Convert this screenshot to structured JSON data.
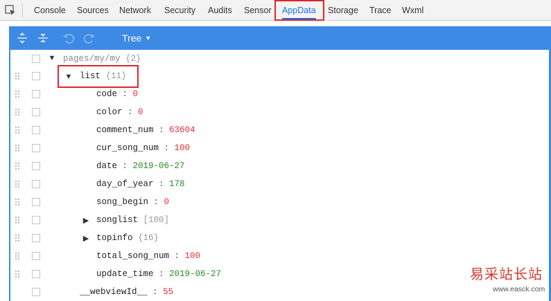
{
  "devtools": {
    "tabs": [
      {
        "label": "Console"
      },
      {
        "label": "Sources"
      },
      {
        "label": "Network"
      },
      {
        "label": "Security"
      },
      {
        "label": "Audits"
      },
      {
        "label": "Sensor"
      },
      {
        "label": "AppData",
        "active": true
      },
      {
        "label": "Storage"
      },
      {
        "label": "Trace"
      },
      {
        "label": "Wxml"
      }
    ],
    "accent_color": "#1a73e8",
    "highlight_color": "#e0242a"
  },
  "toolbar": {
    "background": "#3c8ae4",
    "icons": [
      "expand-all-icon",
      "collapse-all-icon",
      "undo-icon",
      "redo-icon"
    ],
    "view_mode": "Tree"
  },
  "tree": {
    "root": {
      "key": "pages/my/my",
      "count": "{2}"
    },
    "list": {
      "key": "list",
      "count": "{11}"
    },
    "list_items": [
      {
        "key": "code",
        "value": "0",
        "type": "num"
      },
      {
        "key": "color",
        "value": "0",
        "type": "num"
      },
      {
        "key": "comment_num",
        "value": "63604",
        "type": "num"
      },
      {
        "key": "cur_song_num",
        "value": "100",
        "type": "num"
      },
      {
        "key": "date",
        "value": "2019-06-27",
        "type": "str"
      },
      {
        "key": "day_of_year",
        "value": "178",
        "type": "str"
      },
      {
        "key": "song_begin",
        "value": "0",
        "type": "num"
      },
      {
        "key": "songlist",
        "value": "[100]",
        "type": "cnt",
        "collapsed": true
      },
      {
        "key": "topinfo",
        "value": "{16}",
        "type": "cnt",
        "collapsed": true
      },
      {
        "key": "total_song_num",
        "value": "100",
        "type": "num"
      },
      {
        "key": "update_time",
        "value": "2019-06-27",
        "type": "str"
      }
    ],
    "webview": {
      "key": "__webviewId__",
      "value": "55"
    }
  },
  "watermark": {
    "text": "易采站长站",
    "url": "www.easck.com"
  }
}
